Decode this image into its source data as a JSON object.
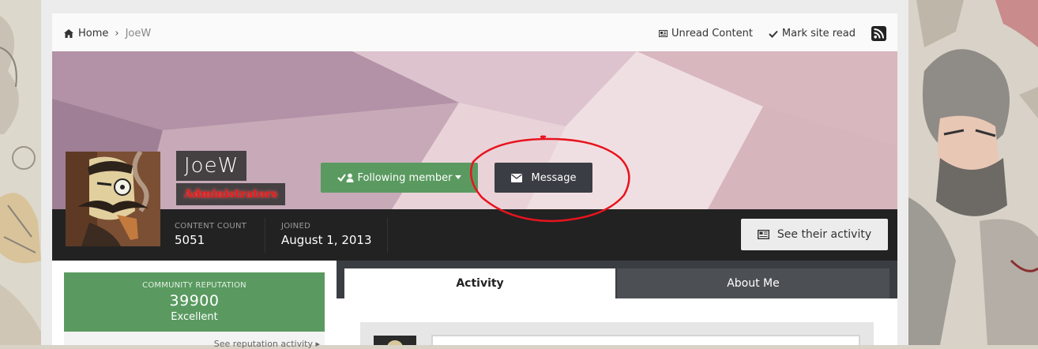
{
  "breadcrumb": {
    "home_label": "Home",
    "separator": "›",
    "current": "JoeW"
  },
  "toolbar": {
    "unread_label": "Unread Content",
    "mark_read_label": "Mark site read",
    "rss_icon": "rss-icon"
  },
  "profile": {
    "name": "JoeW",
    "group": "Administrators",
    "follow_label": "Following member",
    "message_label": "Message",
    "stats": [
      {
        "label": "CONTENT COUNT",
        "value": "5051"
      },
      {
        "label": "JOINED",
        "value": "August 1, 2013"
      }
    ],
    "activity_button_label": "See their activity"
  },
  "reputation": {
    "label": "COMMUNITY REPUTATION",
    "value": "39900",
    "rank": "Excellent",
    "link_label": "See reputation activity"
  },
  "tabs": [
    {
      "label": "Activity",
      "active": true
    },
    {
      "label": "About Me",
      "active": false
    }
  ],
  "colors": {
    "follow_green": "#5a9a60",
    "message_dark": "#3a3d44",
    "group_red": "#ee1b1b",
    "annotation_red": "#e8141e"
  }
}
